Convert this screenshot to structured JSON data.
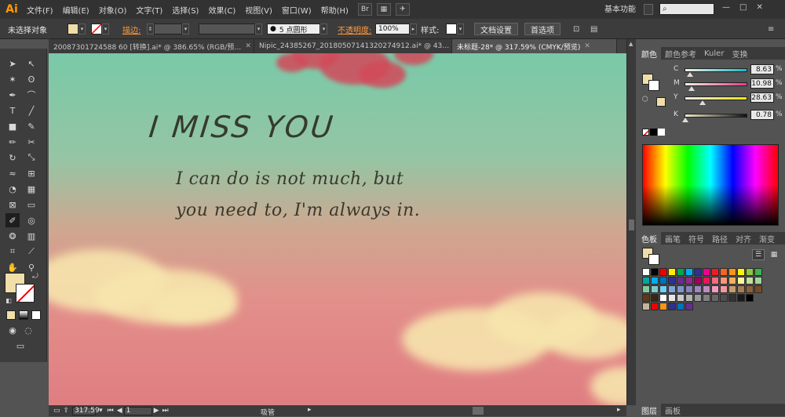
{
  "app": {
    "logo": "Ai"
  },
  "menubar": {
    "items": [
      "文件(F)",
      "编辑(E)",
      "对象(O)",
      "文字(T)",
      "选择(S)",
      "效果(C)",
      "视图(V)",
      "窗口(W)",
      "帮助(H)"
    ],
    "br_label": "Br",
    "workspace": "基本功能",
    "window_min": "—",
    "window_max": "□",
    "window_close": "✕"
  },
  "control": {
    "selection": "未选择对象",
    "stroke_label": "描边:",
    "brush_label": "5 点圆形",
    "opacity_label": "不透明度:",
    "opacity_value": "100%",
    "style_label": "样式:",
    "doc_settings": "文档设置",
    "preferences": "首选项"
  },
  "tabs": [
    {
      "label": "20087301724588 60 [转换].ai* @ 386.65% (RGB/预…",
      "active": false
    },
    {
      "label": "Nipic_24385267_20180507141320274912.ai* @ 43…",
      "active": false
    },
    {
      "label": "未标题-28* @ 317.59% (CMYK/预览)",
      "active": true
    }
  ],
  "canvas": {
    "headline": "I MISS YOU",
    "line1": "I can do is not much, but",
    "line2": "you need to, I'm always in."
  },
  "status": {
    "zoom": "317.59",
    "page": "1",
    "tool_name": "吸管"
  },
  "color_panel": {
    "tabs": [
      "颜色",
      "颜色参考",
      "Kuler",
      "变换"
    ],
    "sliders": [
      {
        "label": "C",
        "value": "8.63",
        "pct": 0.0863,
        "color": "#1ab7c9"
      },
      {
        "label": "M",
        "value": "10.98",
        "pct": 0.1098,
        "color": "#e83a8b"
      },
      {
        "label": "Y",
        "value": "28.63",
        "pct": 0.2863,
        "color": "#f2e600"
      },
      {
        "label": "K",
        "value": "0.78",
        "pct": 0.0078,
        "color": "#2c2c2c"
      }
    ],
    "unit": "%"
  },
  "swatch_panel": {
    "tabs": [
      "色板",
      "画笔",
      "符号",
      "路径",
      "对齐",
      "渐变"
    ]
  },
  "layer_panel": {
    "tabs": [
      "图层",
      "画板"
    ]
  },
  "colors": {
    "fill": "#f0dfa8",
    "accent_orange": "#ff9a40"
  }
}
